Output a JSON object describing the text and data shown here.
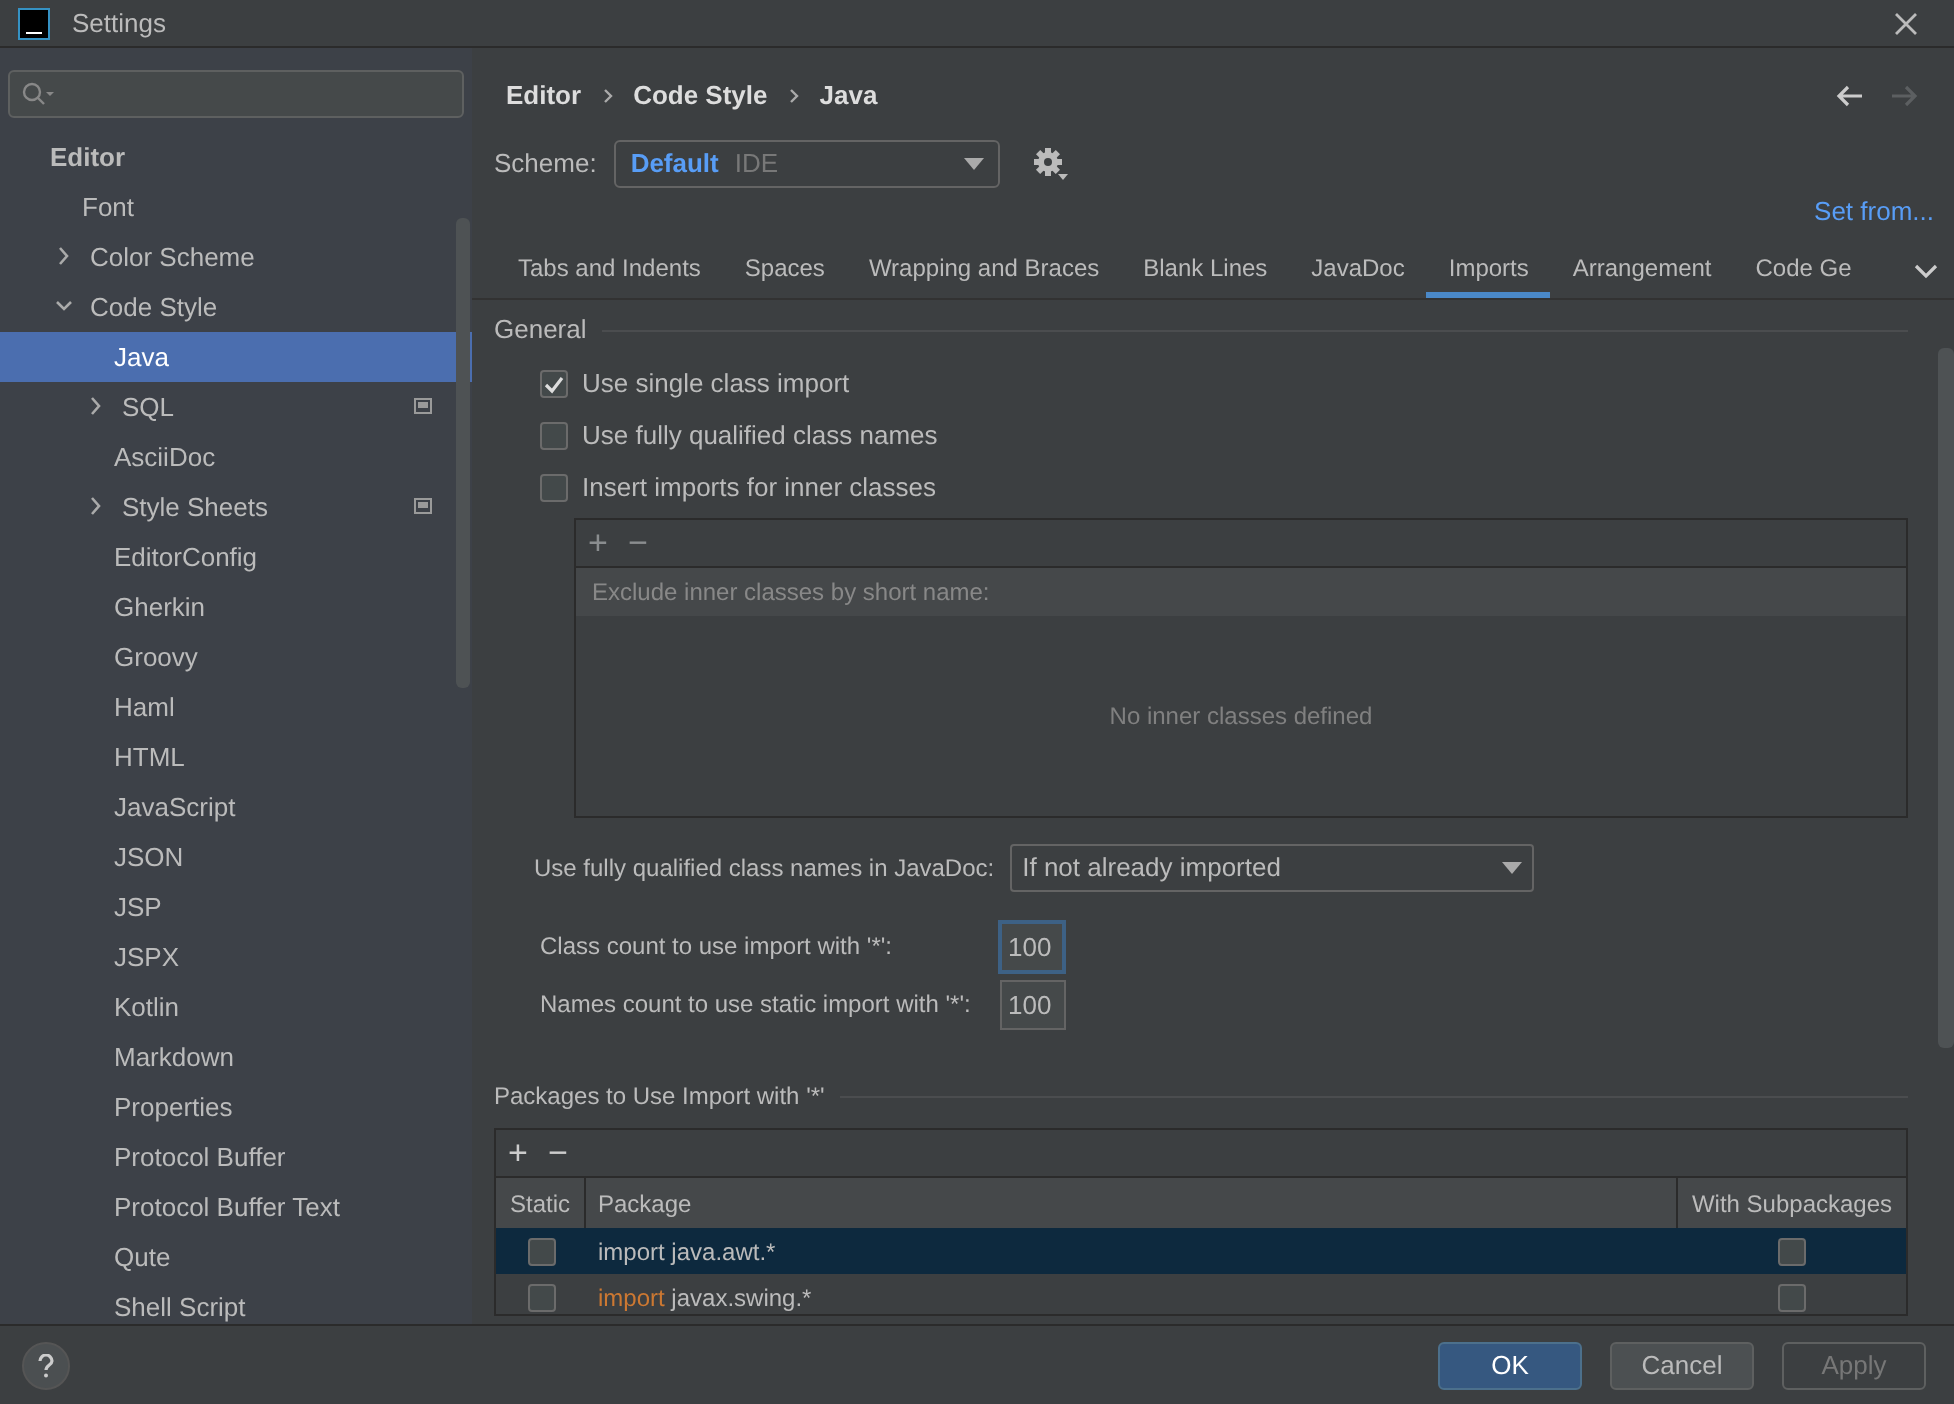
{
  "window": {
    "title": "Settings"
  },
  "sidebar": {
    "items": [
      {
        "label": "Editor",
        "kind": "header",
        "selected": false,
        "children": [
          {
            "label": "Font",
            "kind": "leaf",
            "selected": false
          },
          {
            "label": "Color Scheme",
            "kind": "folder",
            "expanded": false,
            "selected": false
          },
          {
            "label": "Code Style",
            "kind": "folder",
            "expanded": true,
            "selected": false,
            "children": [
              {
                "label": "Java",
                "kind": "leaf",
                "selected": true
              },
              {
                "label": "SQL",
                "kind": "folder",
                "expanded": false,
                "selected": false,
                "project_scheme": true
              },
              {
                "label": "AsciiDoc",
                "kind": "leaf",
                "selected": false
              },
              {
                "label": "Style Sheets",
                "kind": "folder",
                "expanded": false,
                "selected": false,
                "project_scheme": true
              },
              {
                "label": "EditorConfig",
                "kind": "leaf",
                "selected": false
              },
              {
                "label": "Gherkin",
                "kind": "leaf",
                "selected": false
              },
              {
                "label": "Groovy",
                "kind": "leaf",
                "selected": false
              },
              {
                "label": "Haml",
                "kind": "leaf",
                "selected": false
              },
              {
                "label": "HTML",
                "kind": "leaf",
                "selected": false
              },
              {
                "label": "JavaScript",
                "kind": "leaf",
                "selected": false
              },
              {
                "label": "JSON",
                "kind": "leaf",
                "selected": false
              },
              {
                "label": "JSP",
                "kind": "leaf",
                "selected": false
              },
              {
                "label": "JSPX",
                "kind": "leaf",
                "selected": false
              },
              {
                "label": "Kotlin",
                "kind": "leaf",
                "selected": false
              },
              {
                "label": "Markdown",
                "kind": "leaf",
                "selected": false
              },
              {
                "label": "Properties",
                "kind": "leaf",
                "selected": false
              },
              {
                "label": "Protocol Buffer",
                "kind": "leaf",
                "selected": false
              },
              {
                "label": "Protocol Buffer Text",
                "kind": "leaf",
                "selected": false
              },
              {
                "label": "Qute",
                "kind": "leaf",
                "selected": false
              },
              {
                "label": "Shell Script",
                "kind": "leaf",
                "selected": false
              }
            ]
          }
        ]
      }
    ]
  },
  "breadcrumb": [
    "Editor",
    "Code Style",
    "Java"
  ],
  "scheme": {
    "label": "Scheme:",
    "name": "Default",
    "type": "IDE"
  },
  "set_from": "Set from...",
  "tabs": [
    {
      "label": "Tabs and Indents",
      "selected": false
    },
    {
      "label": "Spaces",
      "selected": false
    },
    {
      "label": "Wrapping and Braces",
      "selected": false
    },
    {
      "label": "Blank Lines",
      "selected": false
    },
    {
      "label": "JavaDoc",
      "selected": false
    },
    {
      "label": "Imports",
      "selected": true
    },
    {
      "label": "Arrangement",
      "selected": false
    },
    {
      "label": "Code Ge",
      "selected": false
    }
  ],
  "general": {
    "title": "General",
    "options": [
      {
        "label": "Use single class import",
        "checked": true
      },
      {
        "label": "Use fully qualified class names",
        "checked": false
      },
      {
        "label": "Insert imports for inner classes",
        "checked": false
      }
    ],
    "inner_classes": {
      "header": "Exclude inner classes by short name:",
      "empty_text": "No inner classes defined",
      "toolbar": [
        "+",
        "−"
      ]
    },
    "javadoc": {
      "label": "Use fully qualified class names in JavaDoc:",
      "value": "If not already imported"
    },
    "class_count": {
      "label": "Class count to use import with '*':",
      "value": "100"
    },
    "names_count": {
      "label": "Names count to use static import with '*':",
      "value": "100"
    }
  },
  "packages": {
    "title": "Packages to Use Import with '*'",
    "toolbar": [
      "+",
      "−"
    ],
    "columns": [
      "Static",
      "Package",
      "With Subpackages"
    ],
    "rows": [
      {
        "keyword": "import",
        "package": "java.awt.*",
        "static": false,
        "subpackages": false,
        "selected": true
      },
      {
        "keyword": "import",
        "package": "javax.swing.*",
        "static": false,
        "subpackages": false,
        "selected": false
      }
    ]
  },
  "buttons": [
    {
      "label": "OK",
      "kind": "primary"
    },
    {
      "label": "Cancel",
      "kind": "normal"
    },
    {
      "label": "Apply",
      "kind": "disabled"
    }
  ]
}
